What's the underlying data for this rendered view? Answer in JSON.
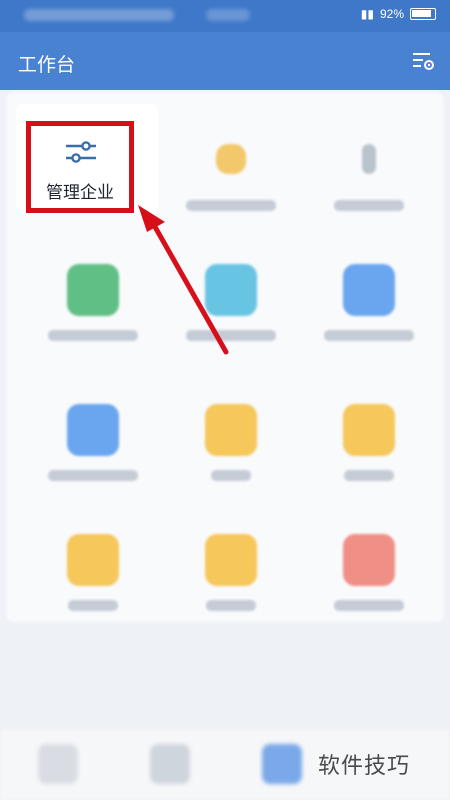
{
  "status_bar": {
    "battery_text": "92%"
  },
  "header": {
    "title": "工作台",
    "settings_icon": "settings-list-gear-icon"
  },
  "highlighted_tile": {
    "label": "管理企业",
    "icon": "sliders-icon"
  },
  "annotation": {
    "box_color": "#d5101b",
    "arrow_color": "#d5101b"
  },
  "watermark": "软件技巧",
  "colors": {
    "header": "#4a82d2",
    "status_bar": "#3f78c9",
    "background": "#eef1f6"
  }
}
